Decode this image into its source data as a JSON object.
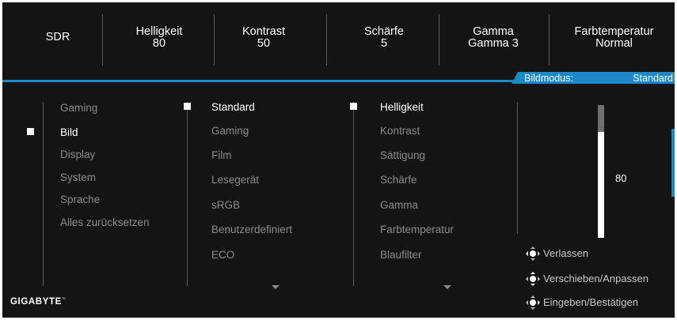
{
  "top_bar": [
    {
      "label": "SDR",
      "value": ""
    },
    {
      "label": "Helligkeit",
      "value": "80"
    },
    {
      "label": "Kontrast",
      "value": "50"
    },
    {
      "label": "Schärfe",
      "value": "5"
    },
    {
      "label": "Gamma",
      "value": "Gamma 3"
    },
    {
      "label": "Farbtemperatur",
      "value": "Normal"
    }
  ],
  "mode_tab": {
    "label": "Bildmodus:",
    "value": "Standard"
  },
  "menu": {
    "main": [
      "Gaming",
      "Bild",
      "Display",
      "System",
      "Sprache",
      "Alles zurücksetzen"
    ],
    "main_selected": "Bild",
    "modes": [
      "Standard",
      "Gaming",
      "Film",
      "Lesegerät",
      "sRGB",
      "Benutzerdefiniert",
      "ECO"
    ],
    "modes_selected": "Standard",
    "settings": [
      "Helligkeit",
      "Kontrast",
      "Sättigung",
      "Schärfe",
      "Gamma",
      "Farbtemperatur",
      "Blaufilter"
    ],
    "settings_selected": "Helligkeit"
  },
  "slider": {
    "value": "80",
    "level_percent": 80
  },
  "hints": [
    "Verlassen",
    "Verschieben/Anpassen",
    "Eingeben/Bestätigen"
  ],
  "brand": "GIGABYTE",
  "colors": {
    "accent": "#1e87c6",
    "background": "#141414",
    "dim_text": "#8c8c8c"
  }
}
